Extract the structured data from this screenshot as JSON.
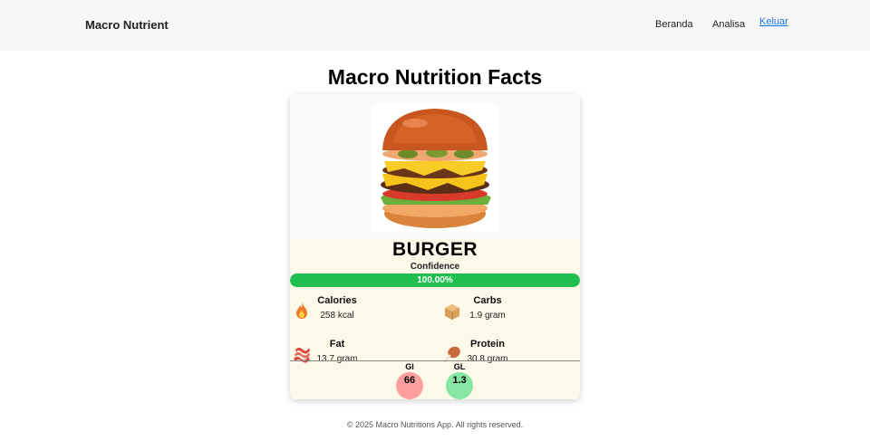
{
  "nav": {
    "brand": "Macro Nutrient",
    "links": [
      "Beranda",
      "Analisa"
    ],
    "logout": "Keluar"
  },
  "page": {
    "title": "Macro Nutrition Facts"
  },
  "result": {
    "food_name": "BURGER",
    "confidence_label": "Confidence",
    "confidence_text": "100.00%",
    "confidence_fraction": 1.0,
    "nutrients": [
      {
        "label": "Calories",
        "value": "258 kcal",
        "icon": "fire-icon"
      },
      {
        "label": "Carbs",
        "value": "1.9 gram",
        "icon": "box-icon"
      },
      {
        "label": "Fat",
        "value": "13.7 gram",
        "icon": "bacon-icon"
      },
      {
        "label": "Protein",
        "value": "30.8 gram",
        "icon": "drumstick-icon"
      }
    ],
    "gi": {
      "label": "GI",
      "value": "66",
      "color": "#ff9e9e"
    },
    "gl": {
      "label": "GL",
      "value": "1.3",
      "color": "#86e6a4"
    }
  },
  "colors": {
    "confidence_bar": "#1fbe4f",
    "link": "#1a73e8",
    "card_bg": "#fdf9e9"
  },
  "footer": {
    "text": "© 2025 Macro Nutritions App. All rights reserved."
  }
}
